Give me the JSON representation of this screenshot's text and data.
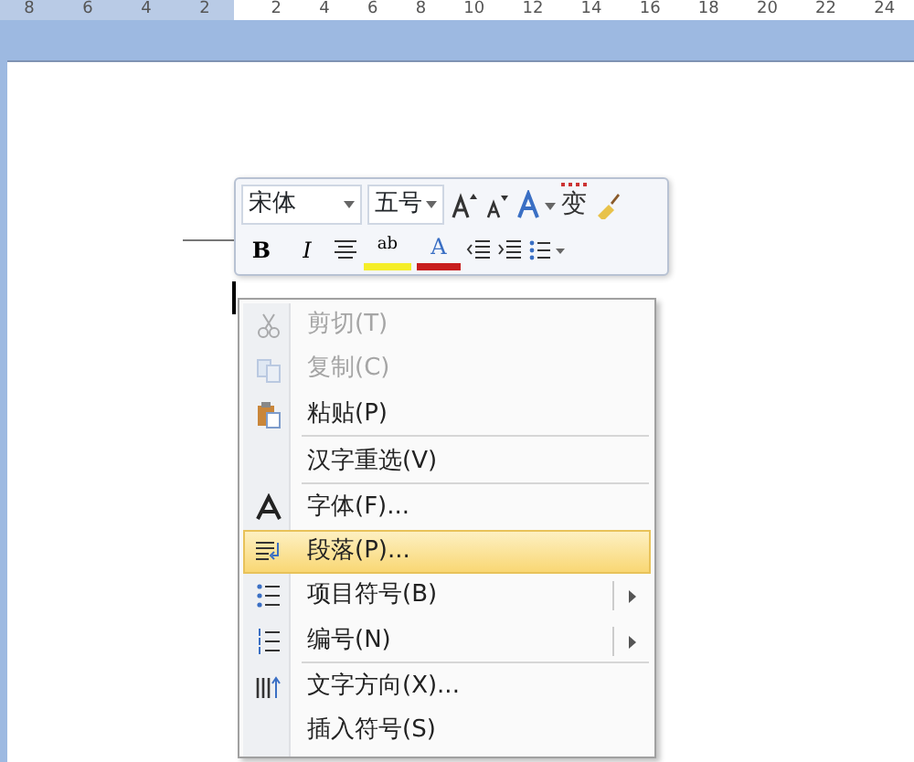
{
  "ruler": {
    "ticks": [
      "8",
      "6",
      "4",
      "2",
      "2",
      "4",
      "6",
      "8",
      "10",
      "12",
      "14",
      "16",
      "18",
      "20",
      "22",
      "24"
    ]
  },
  "mini_toolbar": {
    "font": "宋体",
    "size": "五号",
    "phonetic": "变",
    "tools": [
      {
        "kind": "bold",
        "label": "B"
      },
      {
        "kind": "italic",
        "label": "I"
      },
      {
        "kind": "center"
      },
      {
        "kind": "highlight",
        "label": "ab"
      },
      {
        "kind": "fontcolor",
        "label": "A"
      },
      {
        "kind": "outdent"
      },
      {
        "kind": "indent"
      },
      {
        "kind": "bullets"
      }
    ]
  },
  "context_menu": {
    "items": [
      {
        "label": "剪切(T)",
        "kind": "cut",
        "disabled": true,
        "selected": false,
        "submenu": false
      },
      {
        "label": "复制(C)",
        "kind": "copy",
        "disabled": true,
        "selected": false,
        "submenu": false
      },
      {
        "label": "粘贴(P)",
        "kind": "paste",
        "disabled": false,
        "selected": false,
        "submenu": false,
        "separator_after": true
      },
      {
        "label": "汉字重选(V)",
        "kind": "plain",
        "disabled": false,
        "selected": false,
        "submenu": false,
        "separator_after": true
      },
      {
        "label": "字体(F)...",
        "kind": "font",
        "disabled": false,
        "selected": false,
        "submenu": false
      },
      {
        "label": "段落(P)...",
        "kind": "paragraph",
        "disabled": false,
        "selected": true,
        "submenu": false
      },
      {
        "label": "项目符号(B)",
        "kind": "bullets",
        "disabled": false,
        "selected": false,
        "submenu": true
      },
      {
        "label": "编号(N)",
        "kind": "numbering",
        "disabled": false,
        "selected": false,
        "submenu": true,
        "separator_after": true
      },
      {
        "label": "文字方向(X)...",
        "kind": "direction",
        "disabled": false,
        "selected": false,
        "submenu": false
      },
      {
        "label": "插入符号(S)",
        "kind": "plain",
        "disabled": false,
        "selected": false,
        "submenu": false
      }
    ]
  }
}
